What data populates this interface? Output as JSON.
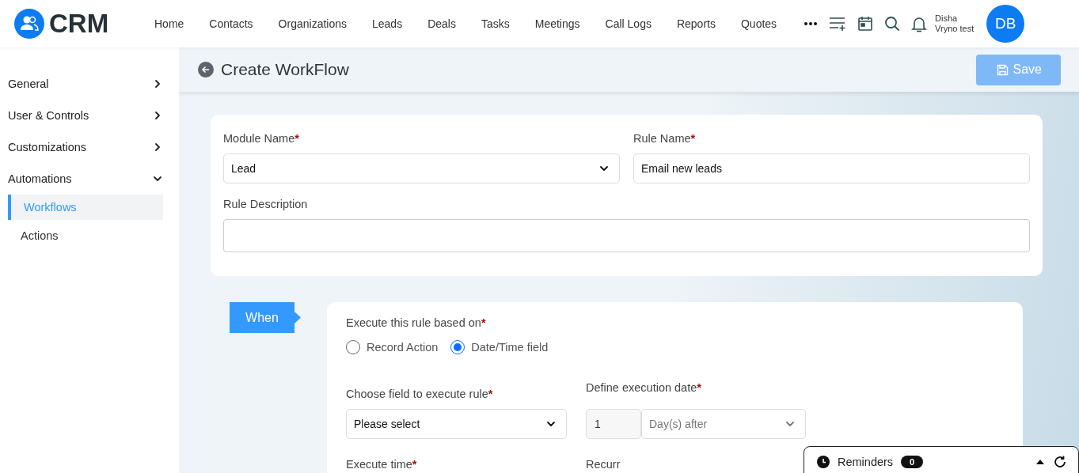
{
  "app": {
    "logo_text": "CRM"
  },
  "nav": [
    {
      "label": "Home"
    },
    {
      "label": "Contacts"
    },
    {
      "label": "Organizations"
    },
    {
      "label": "Leads"
    },
    {
      "label": "Deals"
    },
    {
      "label": "Tasks"
    },
    {
      "label": "Meetings"
    },
    {
      "label": "Call Logs"
    },
    {
      "label": "Reports"
    },
    {
      "label": "Quotes"
    }
  ],
  "user": {
    "name": "Disha",
    "org": "Vryno test",
    "initials": "DB"
  },
  "sidebar": [
    {
      "label": "General",
      "expanded": false
    },
    {
      "label": "User & Controls",
      "expanded": false
    },
    {
      "label": "Customizations",
      "expanded": false
    },
    {
      "label": "Automations",
      "expanded": true,
      "children": [
        {
          "label": "Workflows",
          "selected": true
        },
        {
          "label": "Actions",
          "selected": false
        }
      ]
    }
  ],
  "page": {
    "title": "Create WorkFlow",
    "save_label": "Save",
    "save_disabled": true
  },
  "rule_form": {
    "module": {
      "label": "Module Name",
      "required_mark": "*",
      "value": "Lead"
    },
    "rule_name": {
      "label": "Rule Name",
      "required_mark": "*",
      "value": "Email new leads"
    },
    "description": {
      "label": "Rule Description"
    }
  },
  "when": {
    "badge": "When",
    "basis": {
      "label": "Execute this rule based on",
      "required_mark": "*",
      "options": [
        {
          "label": "Record Action",
          "selected": false
        },
        {
          "label": "Date/Time field",
          "selected": true
        }
      ]
    },
    "field": {
      "label": "Choose field to execute rule",
      "required_mark": "*",
      "value": "Please select"
    },
    "execution_date": {
      "label": "Define execution date",
      "required_mark": "*",
      "count": "1",
      "unit": "Day(s) after"
    },
    "execute_time": {
      "label": "Execute time",
      "required_mark": "*"
    },
    "recurr": {
      "label": "Recurr"
    }
  },
  "reminders": {
    "label": "Reminders",
    "count": "0"
  }
}
